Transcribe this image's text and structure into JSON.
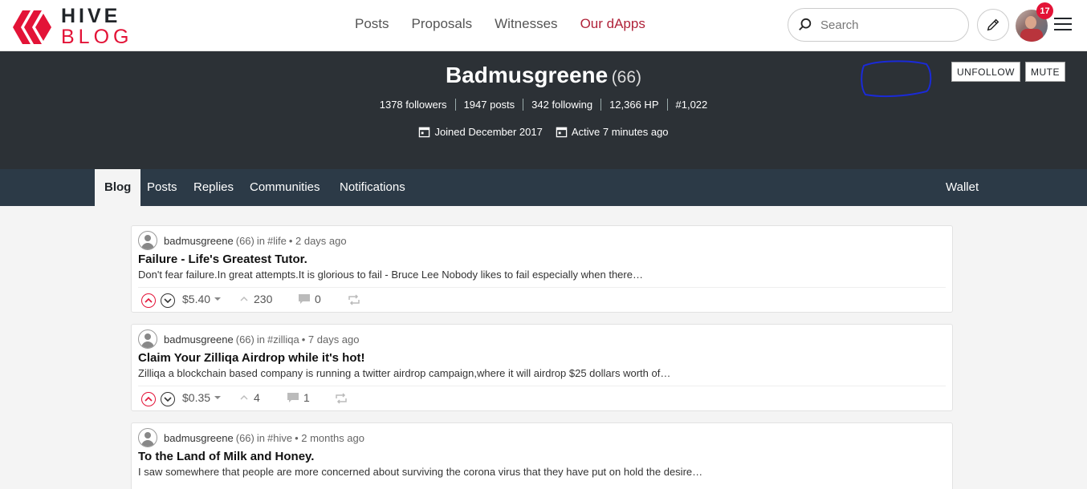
{
  "header": {
    "logo_line1": "HIVE",
    "logo_line2": "BLOG",
    "nav": [
      "Posts",
      "Proposals",
      "Witnesses",
      "Our dApps"
    ],
    "search_placeholder": "Search",
    "notification_count": "17"
  },
  "profile": {
    "name": "Badmusgreene",
    "reputation": "(66)",
    "stats": [
      "1378 followers",
      "1947 posts",
      "342 following",
      "12,366 HP",
      "#1,022"
    ],
    "joined": "Joined December 2017",
    "active": "Active 7 minutes ago",
    "unfollow_label": "UNFOLLOW",
    "mute_label": "MUTE"
  },
  "tabs": {
    "items": [
      "Blog",
      "Posts",
      "Replies",
      "Communities",
      "Notifications"
    ],
    "active": "Blog",
    "wallet": "Wallet"
  },
  "posts": [
    {
      "author": "badmusgreene",
      "reputation": "(66)",
      "community_prefix": "in",
      "community": "#life",
      "time": "• 2 days ago",
      "title": "Failure - Life's Greatest Tutor.",
      "body": "Don't fear failure.In great attempts.It is glorious to fail - Bruce Lee Nobody likes to fail especially when there…",
      "payout": "$5.40",
      "votes": "230",
      "comments": "0"
    },
    {
      "author": "badmusgreene",
      "reputation": "(66)",
      "community_prefix": "in",
      "community": "#zilliqa",
      "time": "• 7 days ago",
      "title": "Claim Your Zilliqa Airdrop while it's hot!",
      "body": "Zilliqa a blockchain based company is running a twitter airdrop campaign,where it will airdrop $25 dollars worth of…",
      "payout": "$0.35",
      "votes": "4",
      "comments": "1"
    },
    {
      "author": "badmusgreene",
      "reputation": "(66)",
      "community_prefix": "in",
      "community": "#hive",
      "time": "• 2 months ago",
      "title": "To the Land of Milk and Honey.",
      "body": "I saw somewhere that people are more concerned about surviving the corona virus that they have put on hold the desire…"
    }
  ],
  "colors": {
    "brand_red": "#e31337",
    "banner": "#2c3136",
    "tabbar": "#2c3a47"
  }
}
